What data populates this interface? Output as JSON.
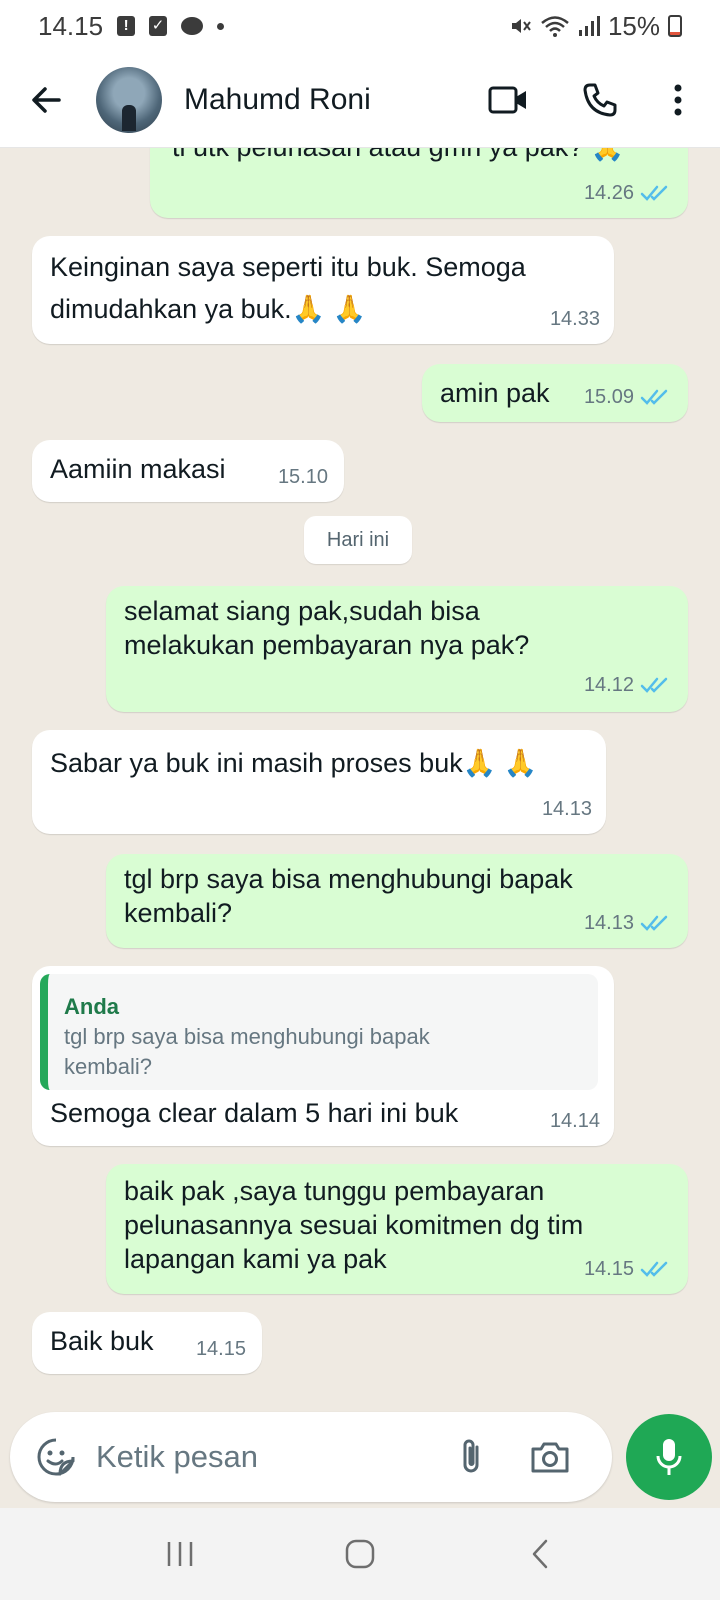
{
  "status_bar": {
    "time": "14.15",
    "battery": "15%",
    "icons": [
      "notification-icon",
      "checkbox-icon",
      "message-icon",
      "dot-icon",
      "mute-icon",
      "wifi-icon",
      "signal-icon",
      "battery-icon"
    ],
    "battery_level": 0.15
  },
  "header": {
    "contact_name": "Mahumd Roni",
    "icons": [
      "back-arrow-icon",
      "video-call-icon",
      "phone-call-icon",
      "more-vert-icon"
    ]
  },
  "messages": [
    {
      "dir": "out",
      "text": "ti utk pelunasan atau gmn ya pak? 🙏",
      "time": "14.26",
      "read": true
    },
    {
      "dir": "in",
      "text": "Keinginan saya seperti itu buk. Semoga\ndimudahkan ya buk.🙏 🙏",
      "time": "14.33"
    },
    {
      "dir": "out",
      "text": "amin pak",
      "time": "15.09",
      "read": true
    },
    {
      "dir": "in",
      "text": "Aamiin makasi",
      "time": "15.10"
    },
    {
      "dir": "out",
      "text": "selamat siang pak,sudah bisa\nmelakukan pembayaran nya pak?",
      "time": "14.12",
      "read": true
    },
    {
      "dir": "in",
      "text": "Sabar ya buk ini masih proses buk🙏 🙏",
      "time": "14.13"
    },
    {
      "dir": "out",
      "text": "tgl brp saya bisa menghubungi bapak\nkembali?",
      "time": "14.13",
      "read": true
    },
    {
      "dir": "in",
      "text": "Semoga clear dalam 5 hari ini buk",
      "time": "14.14",
      "quote": {
        "author": "Anda",
        "text": "tgl brp saya bisa menghubungi bapak\nkembali?"
      }
    },
    {
      "dir": "out",
      "text": "baik pak ,saya tunggu pembayaran\npelunasannya sesuai komitmen dg tim\nlapangan kami ya pak",
      "time": "14.15",
      "read": true
    },
    {
      "dir": "in",
      "text": "Baik buk",
      "time": "14.15"
    }
  ],
  "date_chip": "Hari ini",
  "composer": {
    "placeholder": "Ketik pesan",
    "icons": [
      "sticker-icon",
      "attach-icon",
      "camera-icon",
      "mic-icon"
    ]
  },
  "colors": {
    "chat_bg": "#efeae2",
    "incoming_bubble": "#ffffff",
    "outgoing_bubble": "#d9fdd3",
    "read_ticks": "#53bdeb",
    "accent_green": "#1fa855"
  },
  "navbar": {
    "icons": [
      "recent-apps-icon",
      "home-icon",
      "back-nav-icon"
    ]
  }
}
